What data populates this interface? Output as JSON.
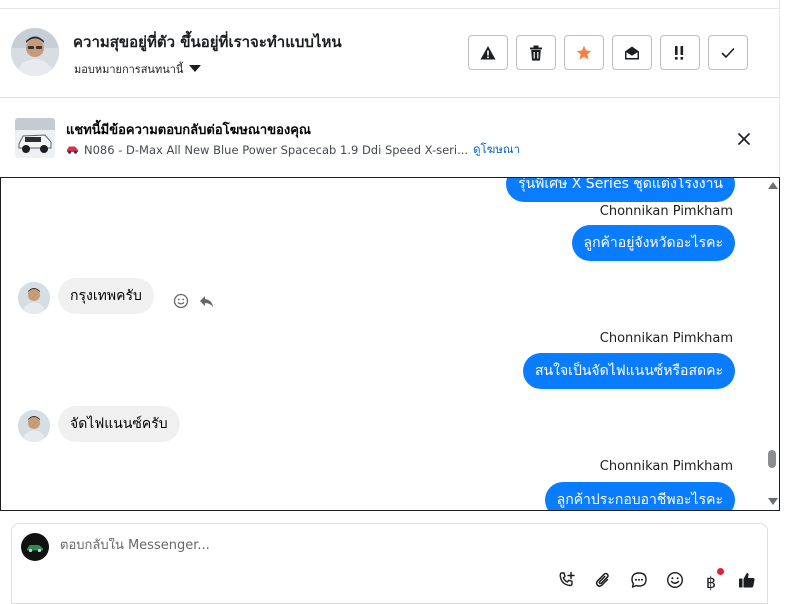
{
  "header": {
    "title": "ความสุขอยู่ที่ตัว ขึ้นอยู่ที่เราจะทำแบบไหน",
    "assign_label": "มอบหมายการสนทนานี้",
    "actions": [
      {
        "name": "warning-icon"
      },
      {
        "name": "trash-icon"
      },
      {
        "name": "star-icon",
        "color": "#f5813d"
      },
      {
        "name": "envelope-open-icon"
      },
      {
        "name": "follow-up-icon"
      },
      {
        "name": "check-icon"
      }
    ]
  },
  "ad": {
    "title": "แชทนี้มีข้อความตอบกลับต่อโฆษณาของคุณ",
    "subtitle": "N086 - D-Max All New Blue Power Spacecab 1.9 Ddi Speed X-seri...",
    "link": "ดูโฆษณา"
  },
  "messages": [
    {
      "direction": "out",
      "text": "รุ่นพิเศษ X Series ชุดแต่งโรงงาน"
    },
    {
      "direction": "out",
      "sender": "Chonnikan Pimkham",
      "text": "ลูกค้าอยู่จังหวัดอะไรคะ"
    },
    {
      "direction": "in",
      "text": "กรุงเทพครับ"
    },
    {
      "direction": "out",
      "sender": "Chonnikan Pimkham",
      "text": "สนใจเป็นจัดไฟแนนซ์หรือสดคะ"
    },
    {
      "direction": "in",
      "text": "จัดไฟแนนซ์ครับ"
    },
    {
      "direction": "out",
      "sender": "Chonnikan Pimkham",
      "text": "ลูกค้าประกอบอาชีพอะไรคะ"
    }
  ],
  "composer": {
    "placeholder": "ตอบกลับใน Messenger...",
    "currency_symbol": "฿"
  },
  "colors": {
    "outgoing_bubble": "#0a7cff",
    "incoming_bubble": "#f0f0f0",
    "link": "#0a66c2",
    "star": "#f5813d",
    "notification_dot": "#e41e3f"
  }
}
